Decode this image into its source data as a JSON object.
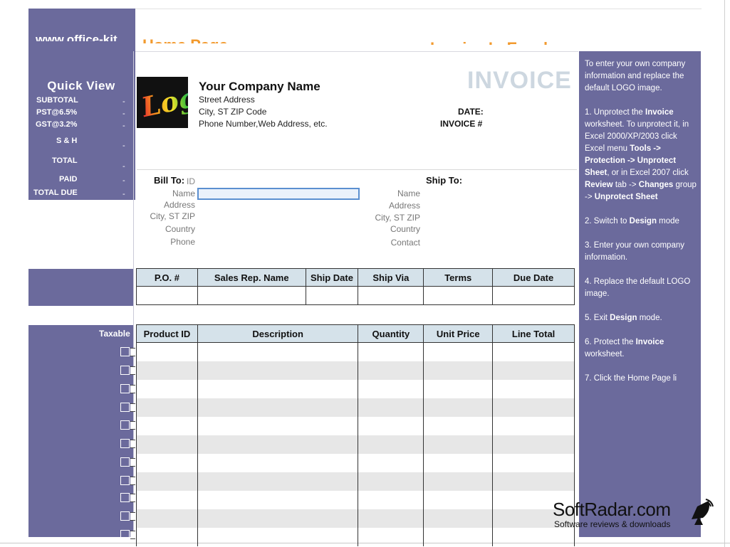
{
  "header": {
    "site_text": "www.office-kit",
    "orange_left": "Home Page",
    "orange_right": "Invoice In Excel"
  },
  "quick_view": {
    "title": "Quick  View",
    "rows": [
      {
        "label": "SUBTOTAL",
        "value": "-"
      },
      {
        "label": "PST@6.5%",
        "value": "-"
      },
      {
        "label": "GST@3.2%",
        "value": "-"
      },
      {
        "label": "S & H",
        "value": "-"
      },
      {
        "label": "TOTAL",
        "value": "-"
      },
      {
        "label": "PAID",
        "value": "-"
      },
      {
        "label": "TOTAL DUE",
        "value": "-"
      }
    ],
    "taxable_label": "Taxable"
  },
  "logo_text": "Logo",
  "company": {
    "name": "Your Company Name",
    "street": "Street Address",
    "city": "City, ST  ZIP Code",
    "contact": "Phone Number,Web Address, etc."
  },
  "invoice": {
    "title": "INVOICE",
    "date_label": "DATE:",
    "number_label": "INVOICE #"
  },
  "bill_to": {
    "heading": "Bill To:",
    "id_label": "ID",
    "labels": [
      "Name",
      "Address",
      "City, ST ZIP",
      "Country",
      "Phone"
    ],
    "name_value": ""
  },
  "ship_to": {
    "heading": "Ship To:",
    "labels": [
      "Name",
      "Address",
      "City, ST ZIP",
      "Country",
      "Contact"
    ]
  },
  "po_table": {
    "headers": [
      "P.O. #",
      "Sales Rep. Name",
      "Ship Date",
      "Ship Via",
      "Terms",
      "Due Date"
    ]
  },
  "product_table": {
    "headers": [
      "Product ID",
      "Description",
      "Quantity",
      "Unit Price",
      "Line Total"
    ]
  },
  "help": {
    "p1": "To enter your own company information and replace the default LOGO image.",
    "p2_a": "1. Unprotect the ",
    "p2_b": "Invoice",
    "p2_c": " worksheet. To unprotect it, in Excel 2000/XP/2003 click Excel menu ",
    "p2_d": "Tools -> Protection -> Unprotect Sheet",
    "p2_e": ", or in Excel 2007 click ",
    "p2_f": "Review",
    "p2_g": " tab -> ",
    "p2_h": "Changes",
    "p2_i": " group -> ",
    "p2_j": "Unprotect Sheet",
    "p3_a": "2. Switch to ",
    "p3_b": "Design",
    "p3_c": " mode",
    "p4": "3. Enter your own company information.",
    "p5": "4. Replace the default LOGO image.",
    "p6_a": "5. Exit ",
    "p6_b": "Design",
    "p6_c": " mode.",
    "p7_a": "6. Protect the ",
    "p7_b": "Invoice",
    "p7_c": " worksheet.",
    "p8": "7. Click the Home Page li"
  },
  "watermark": {
    "title": "SoftRadar.com",
    "subtitle": "Software reviews & downloads"
  }
}
